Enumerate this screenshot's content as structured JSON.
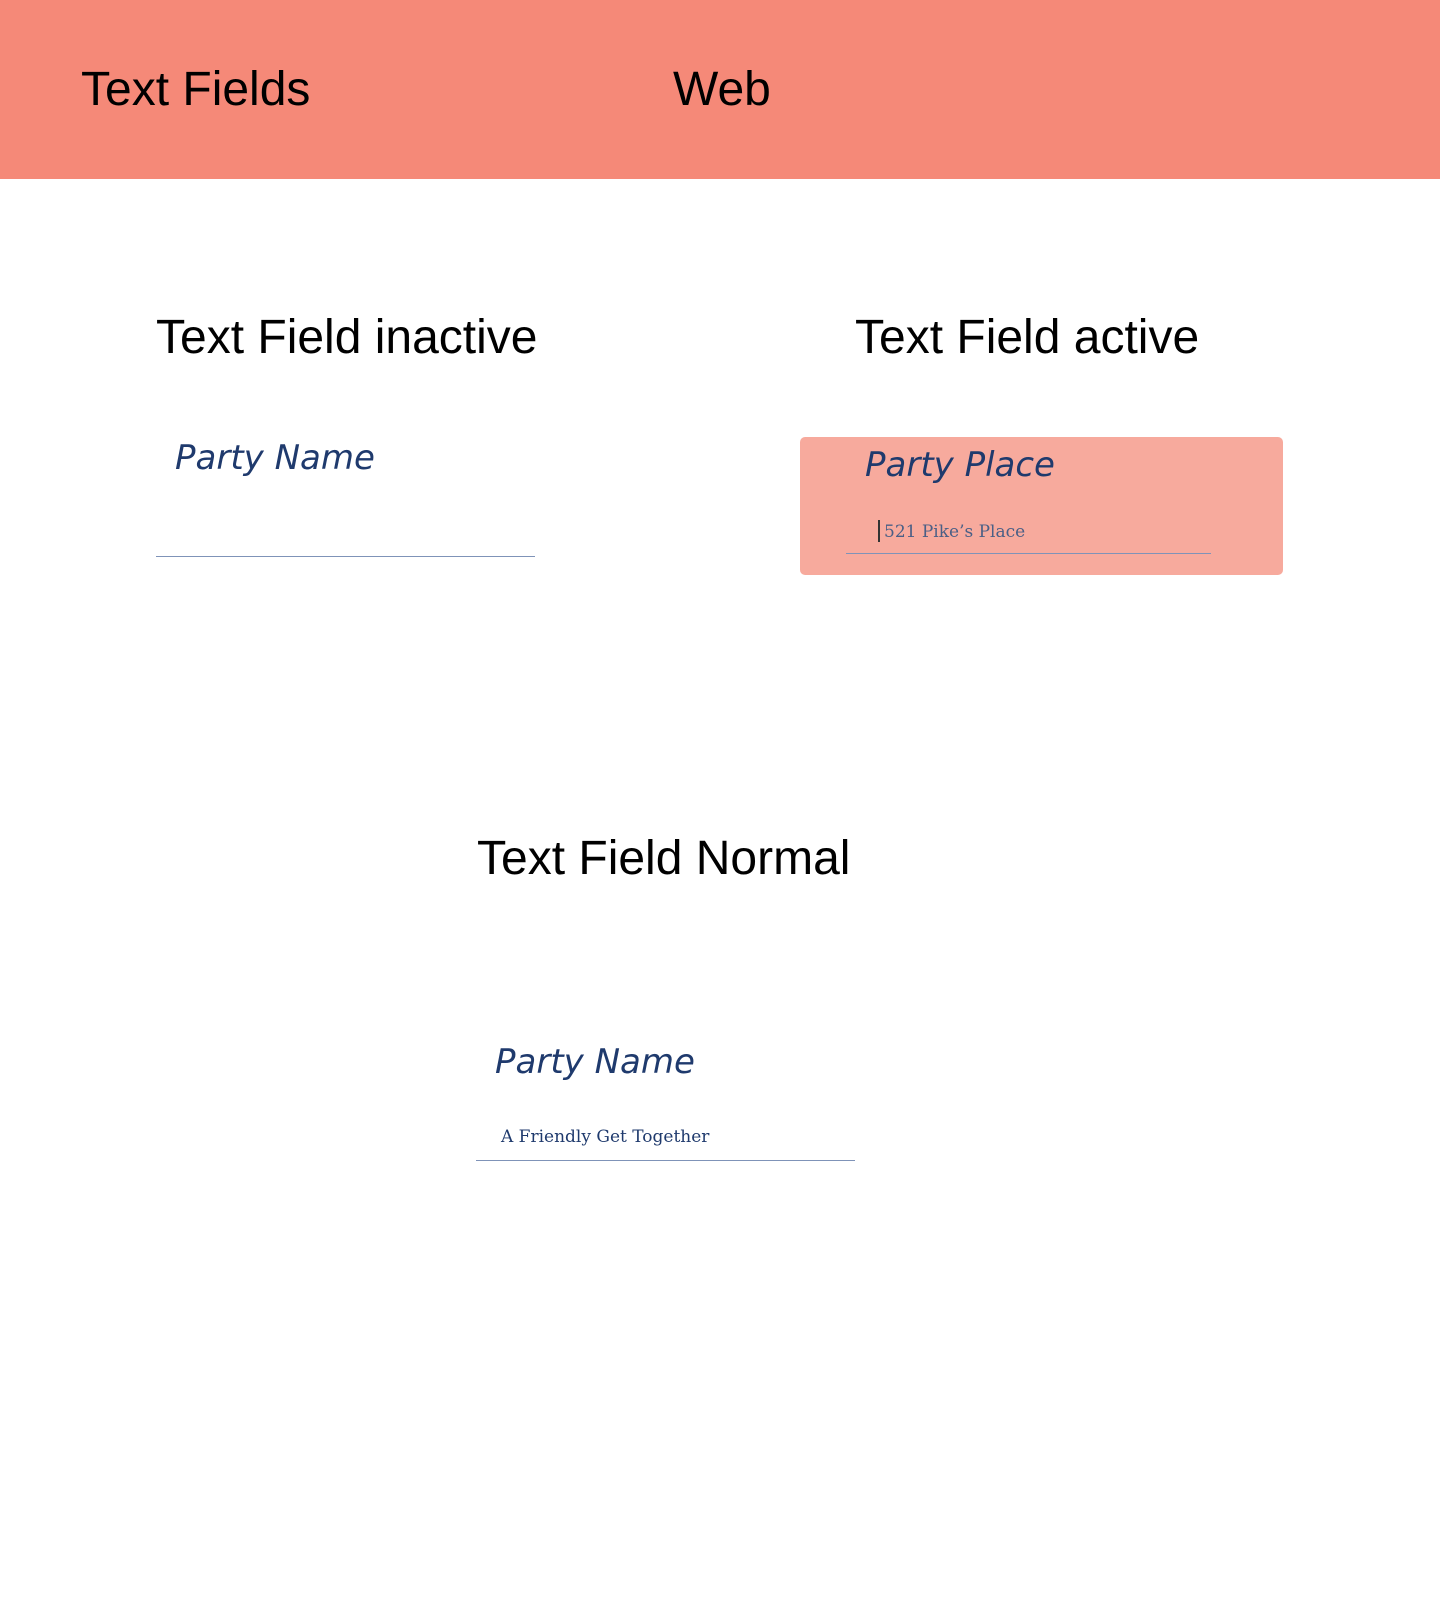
{
  "header": {
    "title": "Text Fields",
    "platform": "Web",
    "background_color": "#f58978"
  },
  "sections": {
    "inactive": {
      "heading": "Text Field inactive",
      "field_label": "Party Name",
      "field_value": ""
    },
    "active": {
      "heading": "Text Field active",
      "field_label": "Party Place",
      "field_value": "521 Pike’s Place",
      "highlight_color": "#f7aa9d"
    },
    "normal": {
      "heading": "Text Field Normal",
      "field_label": "Party Name",
      "field_value": "A Friendly Get Together"
    }
  },
  "colors": {
    "label_text": "#1f3a6d",
    "underline": "#7f93b8"
  }
}
